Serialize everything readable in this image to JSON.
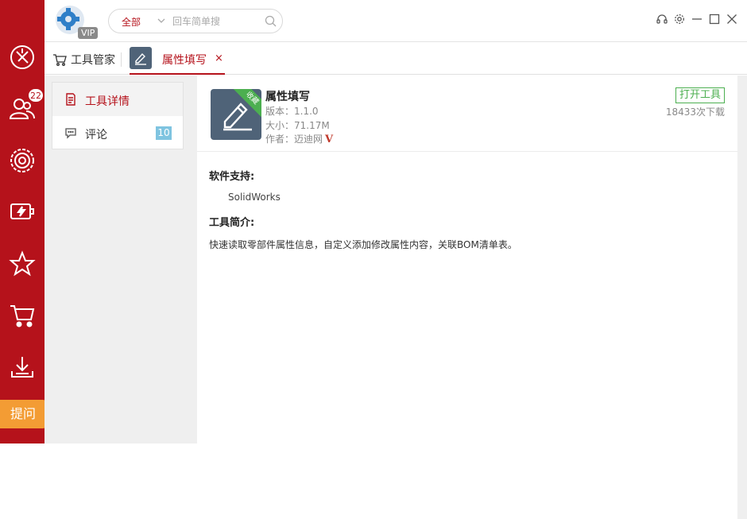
{
  "rail": {
    "badge_count": "22",
    "ask_label": "提问",
    "items": [
      {
        "name": "design-icon"
      },
      {
        "name": "community-icon"
      },
      {
        "name": "gear-ring-icon"
      },
      {
        "name": "battery-charge-icon"
      },
      {
        "name": "star-icon"
      },
      {
        "name": "tool-cart-icon"
      },
      {
        "name": "download-icon"
      }
    ],
    "color": "#b5121b"
  },
  "topbar": {
    "vip_label": "VIP",
    "search": {
      "category": "全部",
      "placeholder": "回车简单搜"
    }
  },
  "tabs": {
    "manager_label": "工具管家",
    "active_label": "属性填写",
    "close_glyph": "×"
  },
  "sidenav": {
    "items": [
      {
        "label": "工具详情",
        "active": true
      },
      {
        "label": "评论",
        "count": "10"
      }
    ]
  },
  "tool": {
    "name": "属性填写",
    "ribbon": "收藏",
    "version": "版本：1.1.0",
    "size": "大小：71.17M",
    "author": "作者：迈迪网",
    "author_mark": "V",
    "open_label": "打开工具",
    "downloads": "18433次下载",
    "support_title": "软件支持:",
    "support_value": "SolidWorks",
    "intro_title": "工具简介:",
    "intro_text": "快速读取零部件属性信息，自定义添加修改属性内容，关联BOM清单表。"
  },
  "colors": {
    "accent": "#b5121b",
    "green": "#4caf50",
    "icon_bg": "#4f6378",
    "badge_blue": "#7fc4e0"
  }
}
